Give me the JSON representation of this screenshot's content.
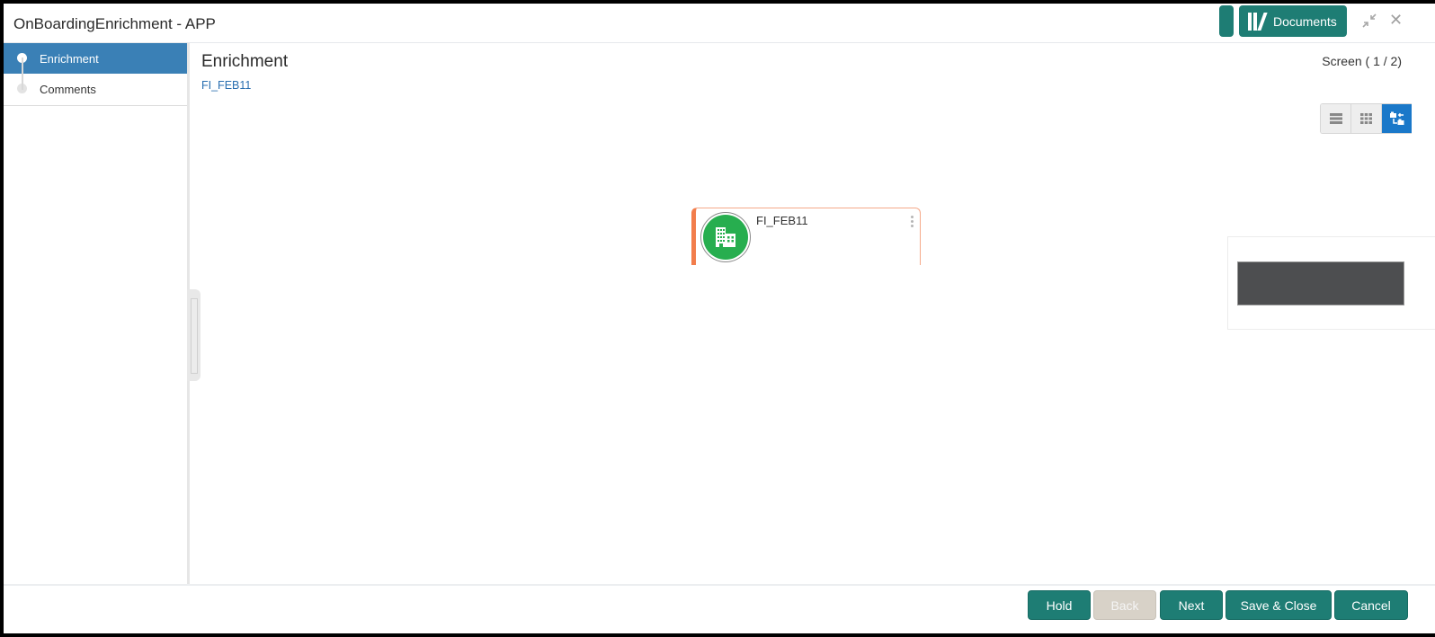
{
  "window": {
    "title": "OnBoardingEnrichment - APP",
    "documents_label": "Documents",
    "icons": {
      "documents": "books-icon",
      "minimize": "minimize-arrows-icon",
      "close": "close-icon"
    }
  },
  "sidebar": {
    "steps": [
      {
        "label": "Enrichment",
        "active": true
      },
      {
        "label": "Comments",
        "active": false
      }
    ]
  },
  "main": {
    "title": "Enrichment",
    "subtitle": "FI_FEB11",
    "screen_indicator": "Screen ( 1 / 2)",
    "view_toggle": [
      {
        "icon": "list-view-icon",
        "active": false
      },
      {
        "icon": "grid-view-icon",
        "active": false
      },
      {
        "icon": "hierarchy-view-icon",
        "active": true
      }
    ],
    "node": {
      "name": "FI_FEB11",
      "icon": "building-icon",
      "accent_color": "#f27d4b",
      "avatar_color": "#27ae4f"
    }
  },
  "footer": {
    "buttons": [
      {
        "label": "Hold",
        "enabled": true
      },
      {
        "label": "Back",
        "enabled": false
      },
      {
        "label": "Next",
        "enabled": true
      },
      {
        "label": "Save & Close",
        "enabled": true
      },
      {
        "label": "Cancel",
        "enabled": true
      }
    ]
  },
  "colors": {
    "primary_button": "#1e7d74",
    "active_step": "#3a80b6",
    "link": "#2a6fb0",
    "toggle_active": "#1a78c9"
  }
}
